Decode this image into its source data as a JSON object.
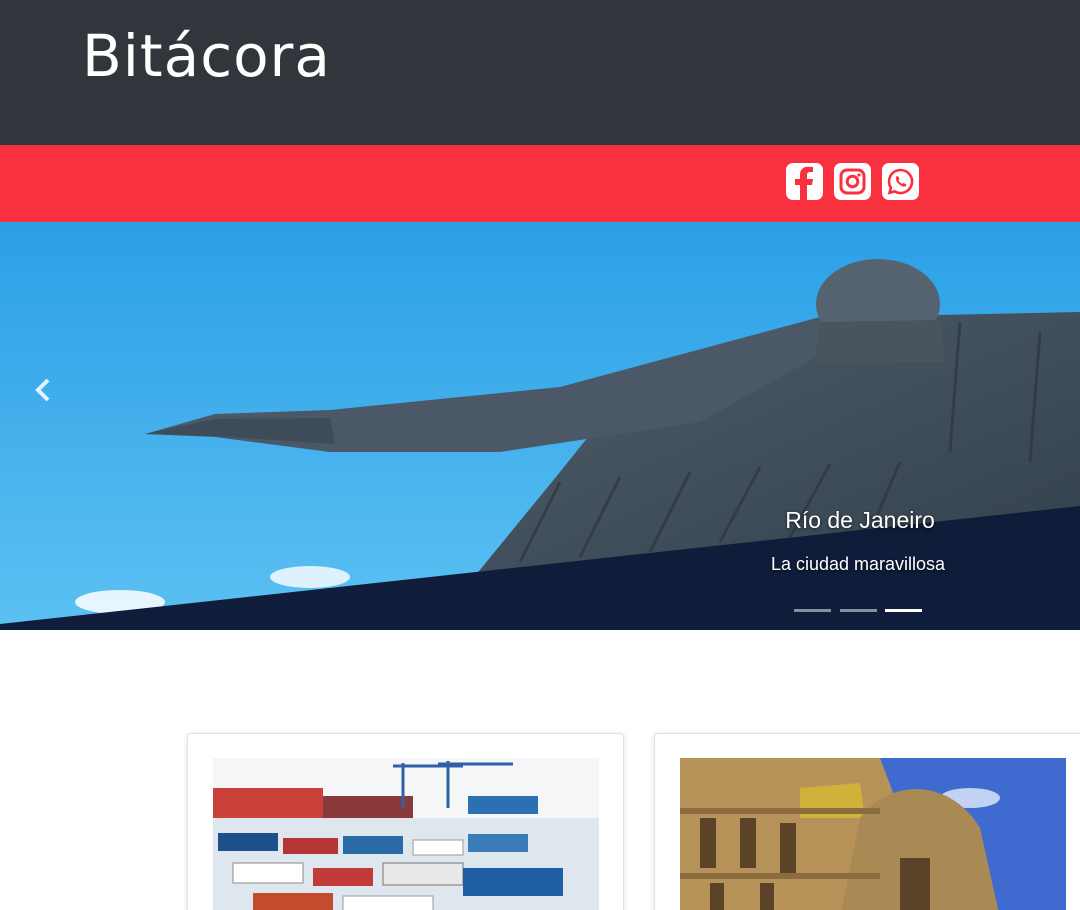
{
  "header": {
    "brand": "Bitácora"
  },
  "social": {
    "icons": [
      "facebook-icon",
      "instagram-icon",
      "whatsapp-icon"
    ],
    "color": "#ffffff"
  },
  "colors": {
    "header_bg": "#31363d",
    "accent": "#f9313f"
  },
  "carousel": {
    "caption_title": "Río de Janeiro",
    "caption_text": "La ciudad maravillosa",
    "slide_count": 3,
    "active_slide": 3
  },
  "cards": [
    {
      "image": "harbor-boats-photo"
    },
    {
      "image": "palace-facade-photo"
    }
  ]
}
